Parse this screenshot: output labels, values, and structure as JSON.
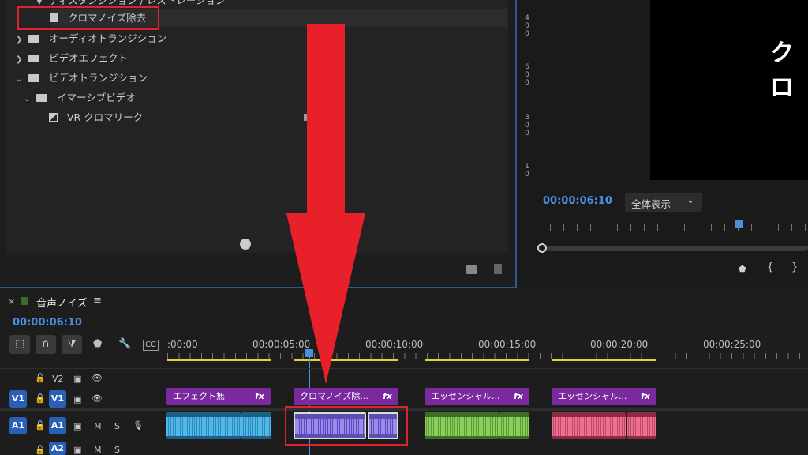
{
  "effects_panel": {
    "items": [
      {
        "label": "ディスタンジション / レストレーション",
        "type": "folder-partial"
      },
      {
        "label": "クロマノイズ除去",
        "type": "effect"
      },
      {
        "label": "オーディオトランジション",
        "type": "folder"
      },
      {
        "label": "ビデオエフェクト",
        "type": "folder"
      },
      {
        "label": "ビデオトランジション",
        "type": "folder"
      },
      {
        "label": "イマーシブビデオ",
        "type": "folder"
      },
      {
        "label": "VR クロマリーク",
        "type": "effect"
      }
    ]
  },
  "monitor": {
    "overlay_text": "クロ",
    "timecode": "00:00:06:10",
    "zoom_select": "全体表示",
    "ruler_digits": [
      [
        "4",
        "0",
        "0"
      ],
      [
        "6",
        "0",
        "0"
      ],
      [
        "8",
        "0",
        "0"
      ],
      [
        "1",
        "0"
      ]
    ]
  },
  "timeline": {
    "close": "×",
    "sequence_name": "音声ノイズ",
    "menu": "≡",
    "timecode": "00:00:06:10",
    "ticks": [
      ":00:00",
      "00:00:05:00",
      "00:00:10:00",
      "00:00:15:00",
      "00:00:20:00",
      "00:00:25:00"
    ],
    "tracks": {
      "v2": "V2",
      "v1": "V1",
      "a1": "A1",
      "a2": "A2",
      "m": "M",
      "s": "S"
    },
    "clips": [
      {
        "label": "エフェクト無",
        "fx": "fx"
      },
      {
        "label": "クロマノイズ除...",
        "fx": "fx"
      },
      {
        "label": "エッセンシャル...",
        "fx": "fx"
      },
      {
        "label": "エッセンシャル...",
        "fx": "fx"
      }
    ]
  },
  "colors": {
    "arrow": "#e8202a",
    "highlight_box": "#e0232a",
    "timecode": "#4a90e2",
    "video_clip": "#7a2a9e",
    "audio_blue": "#4fb8e8",
    "audio_purple": "#9b8ce8",
    "audio_green": "#8ccf5a",
    "audio_pink": "#ee6f8f"
  }
}
